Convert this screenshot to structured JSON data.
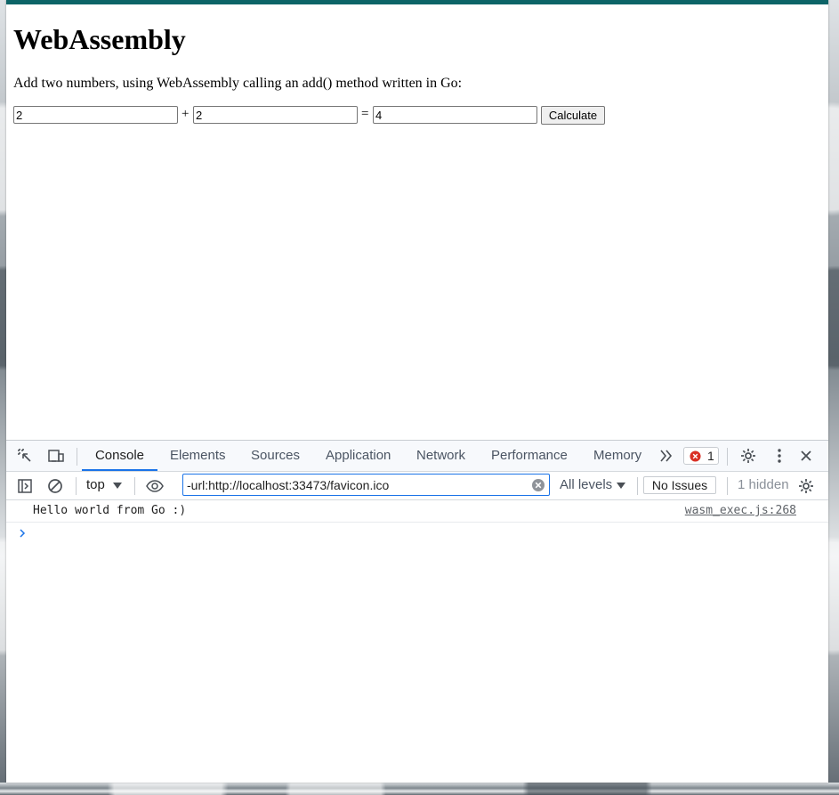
{
  "page": {
    "title": "WebAssembly",
    "description": "Add two numbers, using WebAssembly calling an add() method written in Go:",
    "first_number": "2",
    "plus_sign": "+",
    "second_number": "2",
    "equals_sign": "=",
    "result": "4",
    "calculate_label": "Calculate"
  },
  "devtools": {
    "tabs": [
      "Console",
      "Elements",
      "Sources",
      "Application",
      "Network",
      "Performance",
      "Memory"
    ],
    "active_tab": "Console",
    "error_count": "1",
    "console_toolbar": {
      "context": "top",
      "filter_value": "-url:http://localhost:33473/favicon.ico",
      "levels_label": "All levels",
      "issues_label": "No Issues",
      "hidden_label": "1 hidden"
    },
    "messages": [
      {
        "text": "Hello world from Go :)",
        "source": "wasm_exec.js:268"
      }
    ]
  },
  "colors": {
    "accent_bar": "#0d6467",
    "devtools_active_tab": "#1a73e8",
    "error_badge": "#d93025"
  },
  "icons": {
    "inspect": "inspect-element-icon",
    "device": "device-toolbar-icon",
    "more_tabs": "double-chevron-right-icon",
    "error": "error-circle-x-icon",
    "settings": "gear-icon",
    "menu": "vertical-dots-icon",
    "close": "close-icon",
    "sidebar": "sidebar-toggle-icon",
    "clear_console": "block-circle-icon",
    "live_expression": "eye-icon",
    "clear_filter": "clear-filter-icon",
    "prompt": "chevron-right-icon"
  }
}
